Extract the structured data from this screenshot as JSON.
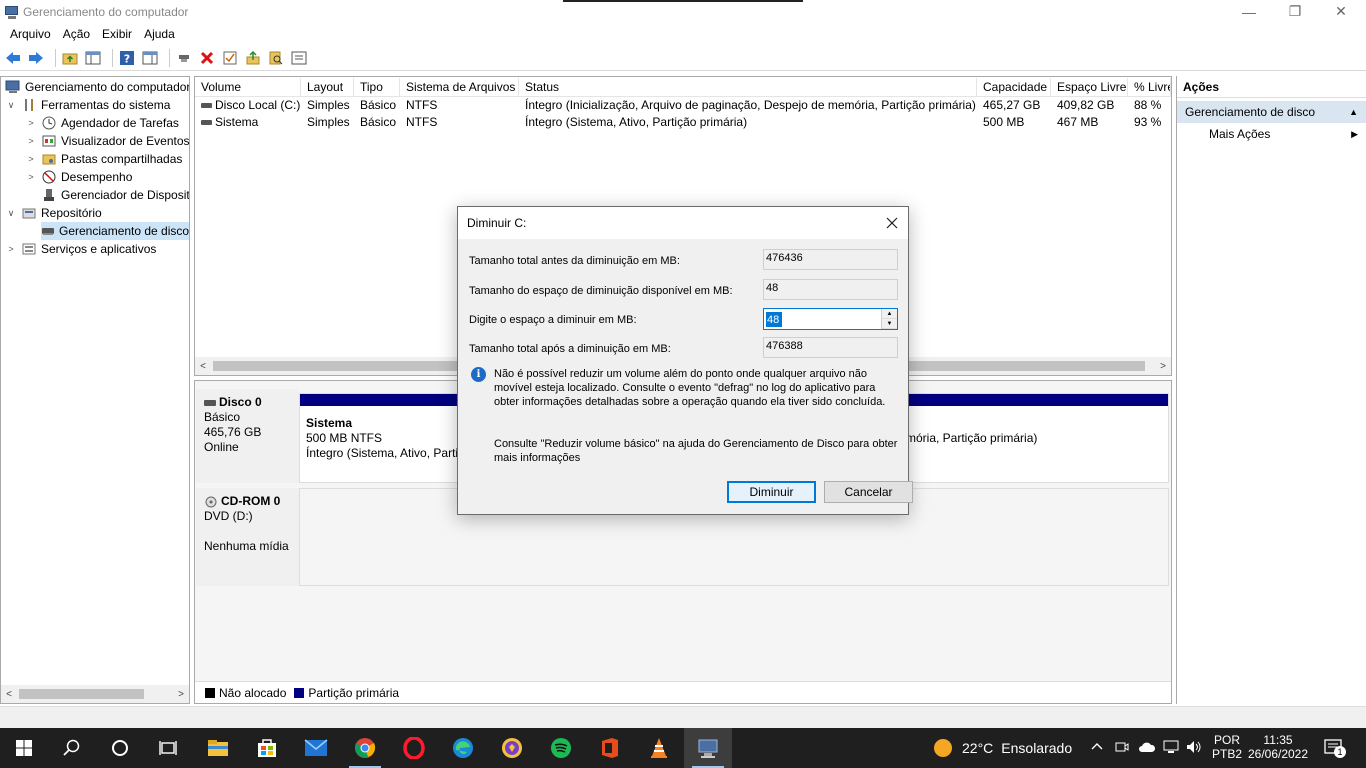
{
  "window": {
    "title": "Gerenciamento do computador",
    "minimize_glyph": "—",
    "restore_glyph": "❐",
    "close_glyph": "✕"
  },
  "menu": [
    "Arquivo",
    "Ação",
    "Exibir",
    "Ajuda"
  ],
  "toolbar_icons": [
    "back-icon",
    "forward-icon",
    "up-folder-icon",
    "show-hide-tree-icon",
    "help-icon",
    "properties-icon",
    "connect-icon",
    "delete-icon",
    "check-icon",
    "export-icon",
    "search-icon",
    "list-icon"
  ],
  "tree": {
    "root": "Gerenciamento do computador",
    "items": [
      {
        "label": "Ferramentas do sistema",
        "level": 1,
        "expander": "∨",
        "icon": "tools-icon"
      },
      {
        "label": "Agendador de Tarefas",
        "level": 2,
        "expander": ">",
        "icon": "clock-icon"
      },
      {
        "label": "Visualizador de Eventos",
        "level": 2,
        "expander": ">",
        "icon": "event-viewer-icon"
      },
      {
        "label": "Pastas compartilhadas",
        "level": 2,
        "expander": ">",
        "icon": "shared-folder-icon"
      },
      {
        "label": "Desempenho",
        "level": 2,
        "expander": ">",
        "icon": "performance-icon"
      },
      {
        "label": "Gerenciador de Dispositivos",
        "level": 2,
        "expander": "",
        "icon": "device-manager-icon"
      },
      {
        "label": "Repositório",
        "level": 1,
        "expander": "∨",
        "icon": "storage-icon"
      },
      {
        "label": "Gerenciamento de disco",
        "level": 2,
        "expander": "",
        "icon": "disk-icon",
        "selected": true
      },
      {
        "label": "Serviços e aplicativos",
        "level": 1,
        "expander": ">",
        "icon": "services-icon"
      }
    ]
  },
  "volumes": {
    "columns": [
      "Volume",
      "Layout",
      "Tipo",
      "Sistema de Arquivos",
      "Status",
      "Capacidade",
      "Espaço Livre",
      "% Livre"
    ],
    "rows": [
      [
        "Disco Local (C:)",
        "Simples",
        "Básico",
        "NTFS",
        "Íntegro (Inicialização, Arquivo de paginação, Despejo de memória, Partição primária)",
        "465,27 GB",
        "409,82 GB",
        "88 %"
      ],
      [
        "Sistema",
        "Simples",
        "Básico",
        "NTFS",
        "Íntegro (Sistema, Ativo, Partição primária)",
        "500 MB",
        "467 MB",
        "93 %"
      ]
    ]
  },
  "disks": {
    "disk0": {
      "name": "Disco 0",
      "type": "Básico",
      "size": "465,76 GB",
      "status": "Online"
    },
    "partition_sistema": {
      "name": "Sistema",
      "size": "500 MB NTFS",
      "status": "Íntegro (Sistema, Ativo, Partição primária)"
    },
    "partition_c_status_tail": "mória, Partição primária)",
    "cdrom": {
      "name": "CD-ROM 0",
      "drive": "DVD (D:)",
      "status": "Nenhuma mídia"
    }
  },
  "legend": {
    "unallocated": "Não alocado",
    "primary": "Partição primária",
    "unallocated_color": "#000000",
    "primary_color": "#000080"
  },
  "actions": {
    "title": "Ações",
    "section": "Gerenciamento de disco",
    "more": "Mais Ações"
  },
  "dialog": {
    "title": "Diminuir C:",
    "total_before_label": "Tamanho total antes da diminuição em MB:",
    "total_before_value": "476436",
    "available_label": "Tamanho do espaço de diminuição disponível em MB:",
    "available_value": "48",
    "enter_label": "Digite o espaço a diminuir em MB:",
    "enter_value": "48",
    "total_after_label": "Tamanho total após a diminuição em MB:",
    "total_after_value": "476388",
    "note": "Não é possível reduzir um volume além do ponto onde qualquer arquivo não movível esteja localizado. Consulte o evento \"defrag\" no log do aplicativo para obter informações detalhadas sobre a operação quando ela tiver sido concluída.",
    "help": "Consulte \"Reduzir volume básico\" na ajuda do Gerenciamento de Disco para obter mais informações",
    "shrink_button": "Diminuir",
    "cancel_button": "Cancelar"
  },
  "taskbar": {
    "apps": [
      "file-explorer-icon",
      "store-icon",
      "mail-icon",
      "chrome-icon",
      "opera-icon",
      "edge-icon",
      "brave-icon",
      "spotify-icon",
      "office-icon",
      "vlc-icon",
      "computer-management-icon"
    ],
    "weather_temp": "22°C",
    "weather_desc": "Ensolarado",
    "lang1": "POR",
    "lang2": "PTB2",
    "time": "11:35",
    "date": "26/06/2022",
    "notification_count": "1"
  }
}
